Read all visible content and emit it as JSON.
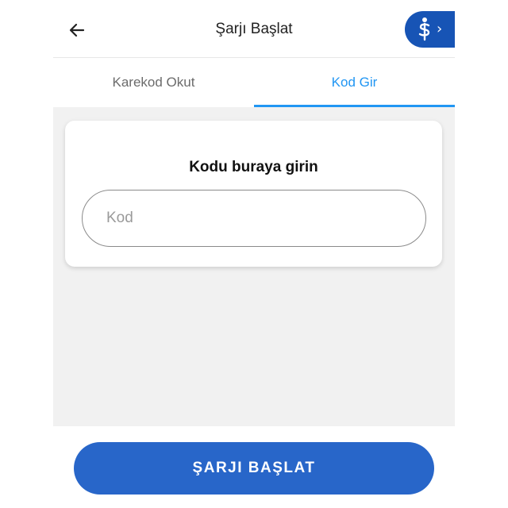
{
  "header": {
    "title": "Şarjı Başlat",
    "back_icon": "arrow-left-icon",
    "brand_icon": "isbank-logo-icon",
    "brand_chevron": "›"
  },
  "tabs": [
    {
      "label": "Karekod Okut",
      "active": false
    },
    {
      "label": "Kod Gir",
      "active": true
    }
  ],
  "card": {
    "title": "Kodu buraya girin",
    "input": {
      "value": "",
      "placeholder": "Kod"
    }
  },
  "footer": {
    "start_label": "ŞARJI BAŞLAT"
  },
  "colors": {
    "accent": "#2196f3",
    "brand": "#1754b5",
    "primary_button": "#2866c9",
    "content_bg": "#f1f1f1"
  }
}
